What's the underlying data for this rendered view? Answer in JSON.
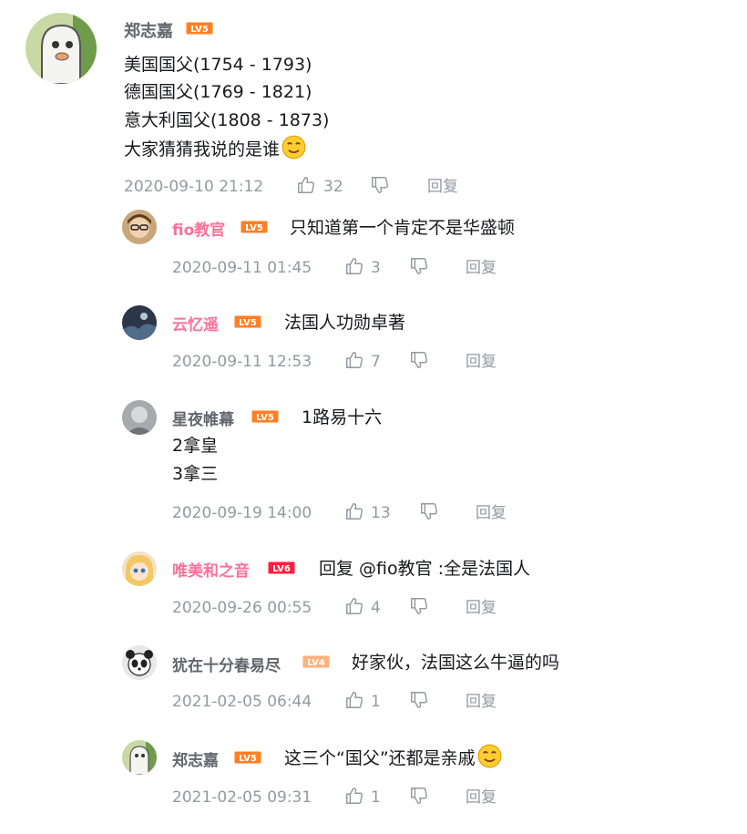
{
  "colors": {
    "name_default": "#61666d",
    "name_vip": "#fb7299",
    "level_badge": "#ff7f24",
    "meta": "#9499a0",
    "text": "#18191c"
  },
  "comment": {
    "user": {
      "name": "郑志嘉",
      "level": "LV5",
      "avatar": "ghost-cartoon-avatar"
    },
    "lines": [
      "美国国父(1754 - 1793)",
      "德国国父(1769 - 1821)",
      "意大利国父(1808 - 1873)",
      "大家猜猜我说的是谁"
    ],
    "emoji": "smug-face-emoji",
    "time": "2020-09-10 21:12",
    "likes": "32",
    "reply_label": "回复"
  },
  "replies": [
    {
      "name": "fio教官",
      "level": "LV5",
      "name_color": "pink",
      "avatar": "fio-avatar",
      "text": "只知道第一个肯定不是华盛顿",
      "time": "2020-09-11 01:45",
      "likes": "3",
      "reply_label": "回复"
    },
    {
      "name": "云忆遥",
      "level": "LV5",
      "name_color": "pink",
      "avatar": "dark-scene-avatar",
      "text": "法国人功勋卓著",
      "time": "2020-09-11 12:53",
      "likes": "7",
      "reply_label": "回复"
    },
    {
      "name": "星夜帷幕",
      "level": "LV5",
      "name_color": "gray",
      "avatar": "gray-avatar",
      "lines": [
        "1路易十六",
        "2拿皇",
        "3拿三"
      ],
      "time": "2020-09-19 14:00",
      "likes": "13",
      "reply_label": "回复"
    },
    {
      "name": "唯美和之音",
      "level": "LV6",
      "name_color": "pink",
      "avatar": "anime-girl-avatar",
      "text": "回复 @fio教官 :全是法国人",
      "time": "2020-09-26 00:55",
      "likes": "4",
      "reply_label": "回复"
    },
    {
      "name": "犹在十分春易尽",
      "level": "LV4",
      "name_color": "gray",
      "avatar": "panda-avatar",
      "text": "好家伙，法国这么牛逼的吗",
      "time": "2021-02-05 06:44",
      "likes": "1",
      "reply_label": "回复"
    },
    {
      "name": "郑志嘉",
      "level": "LV5",
      "name_color": "gray",
      "avatar": "ghost-cartoon-avatar",
      "text": "这三个“国父”还都是亲戚",
      "emoji": "smug-face-emoji",
      "time": "2021-02-05 09:31",
      "likes": "1",
      "reply_label": "回复"
    }
  ]
}
